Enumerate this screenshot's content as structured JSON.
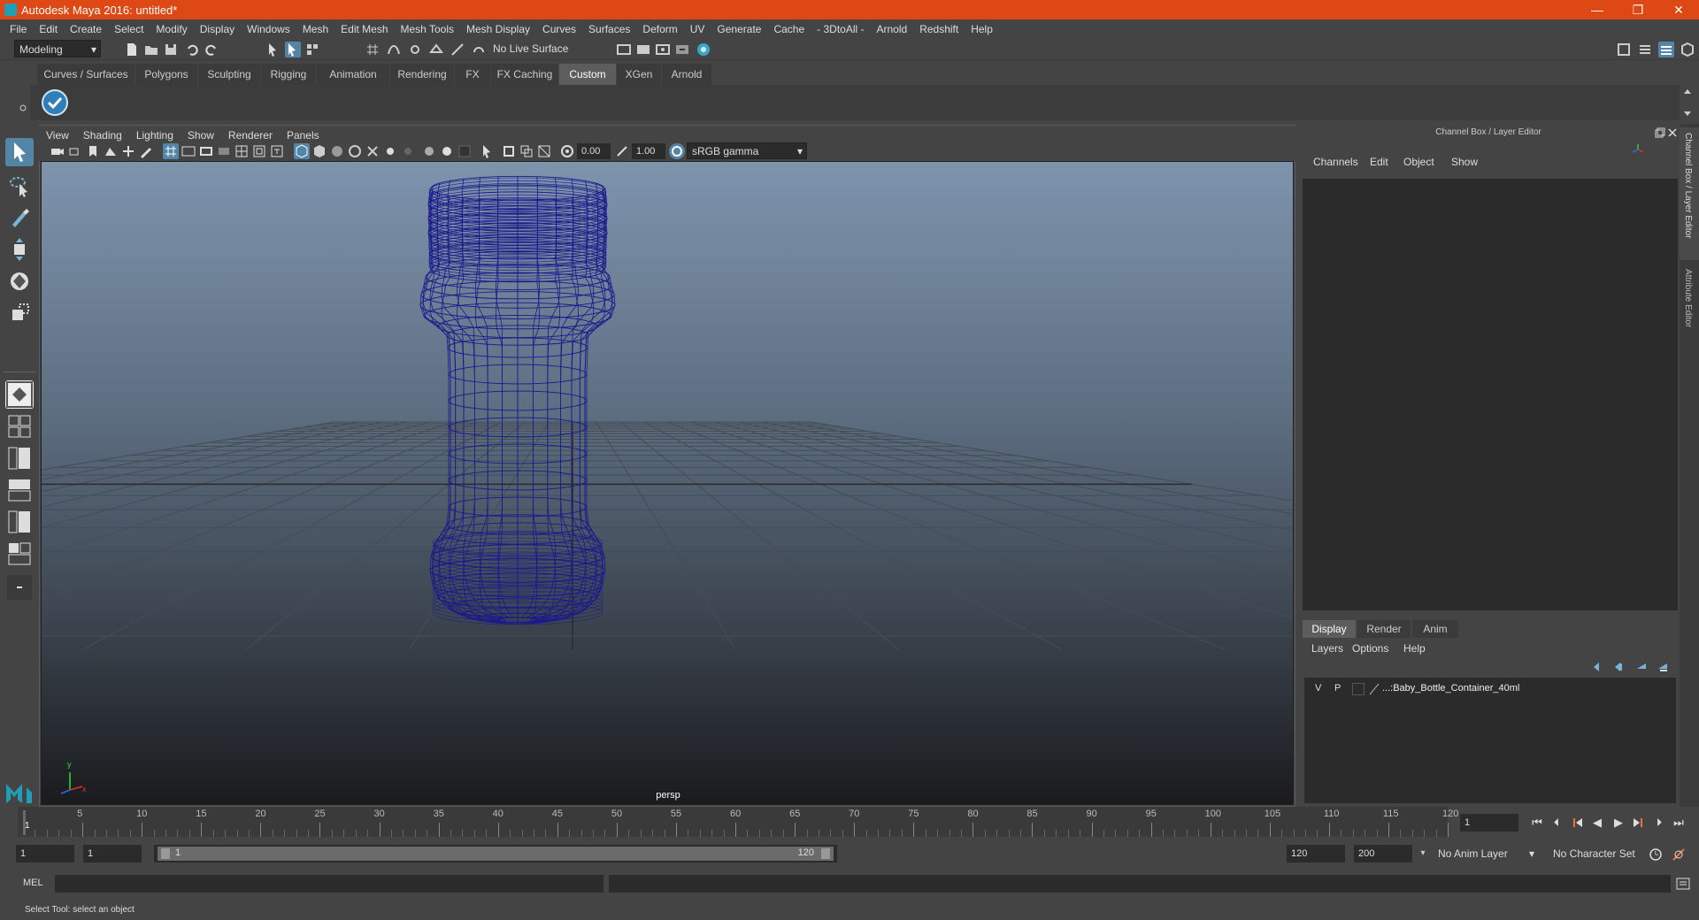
{
  "title_bar": {
    "title": "Autodesk Maya 2016: untitled*",
    "minimize": "—",
    "maximize": "❐",
    "close": "✕"
  },
  "menu": [
    "File",
    "Edit",
    "Create",
    "Select",
    "Modify",
    "Display",
    "Windows",
    "Mesh",
    "Edit Mesh",
    "Mesh Tools",
    "Mesh Display",
    "Curves",
    "Surfaces",
    "Deform",
    "UV",
    "Generate",
    "Cache",
    "- 3DtoAll -",
    "Arnold",
    "Redshift",
    "Help"
  ],
  "status_line": {
    "mode": "Modeling",
    "live_surface": "No Live Surface"
  },
  "shelf_tabs": [
    "Curves / Surfaces",
    "Polygons",
    "Sculpting",
    "Rigging",
    "Animation",
    "Rendering",
    "FX",
    "FX Caching",
    "Custom",
    "XGen",
    "Arnold"
  ],
  "active_shelf_tab": "Custom",
  "panel_menu": [
    "View",
    "Shading",
    "Lighting",
    "Show",
    "Renderer",
    "Panels"
  ],
  "panel_toolbar": {
    "exposure": "0.00",
    "gamma": "1.00",
    "color_space": "sRGB gamma"
  },
  "viewport": {
    "camera_label": "persp",
    "axis_y": "y",
    "axis_x": "x",
    "object_color": "#1a1a8c"
  },
  "channel_box": {
    "header": "Channel Box / Layer Editor",
    "menu": [
      "Channels",
      "Edit",
      "Object",
      "Show"
    ],
    "layer_tabs": [
      "Display",
      "Render",
      "Anim"
    ],
    "active_layer_tab": "Display",
    "layer_menu": [
      "Layers",
      "Options",
      "Help"
    ],
    "layer_row": {
      "v": "V",
      "p": "P",
      "name": "...:Baby_Bottle_Container_40ml"
    }
  },
  "side_tabs": [
    "Channel Box / Layer Editor",
    "Attribute Editor"
  ],
  "timeline": {
    "ticks": [
      "5",
      "10",
      "15",
      "20",
      "25",
      "30",
      "35",
      "40",
      "45",
      "50",
      "55",
      "60",
      "65",
      "70",
      "75",
      "80",
      "85",
      "90",
      "95",
      "100",
      "105",
      "110",
      "115",
      "120"
    ],
    "current_frame_marker": "1",
    "current_frame_field": "1"
  },
  "range": {
    "start": "1",
    "playback_start": "1",
    "slider_start": "1",
    "slider_end": "120",
    "playback_end": "120",
    "end": "200",
    "anim_layer": "No Anim Layer",
    "character_set": "No Character Set"
  },
  "command_line": {
    "label": "MEL"
  },
  "help_line": "Select Tool: select an object"
}
